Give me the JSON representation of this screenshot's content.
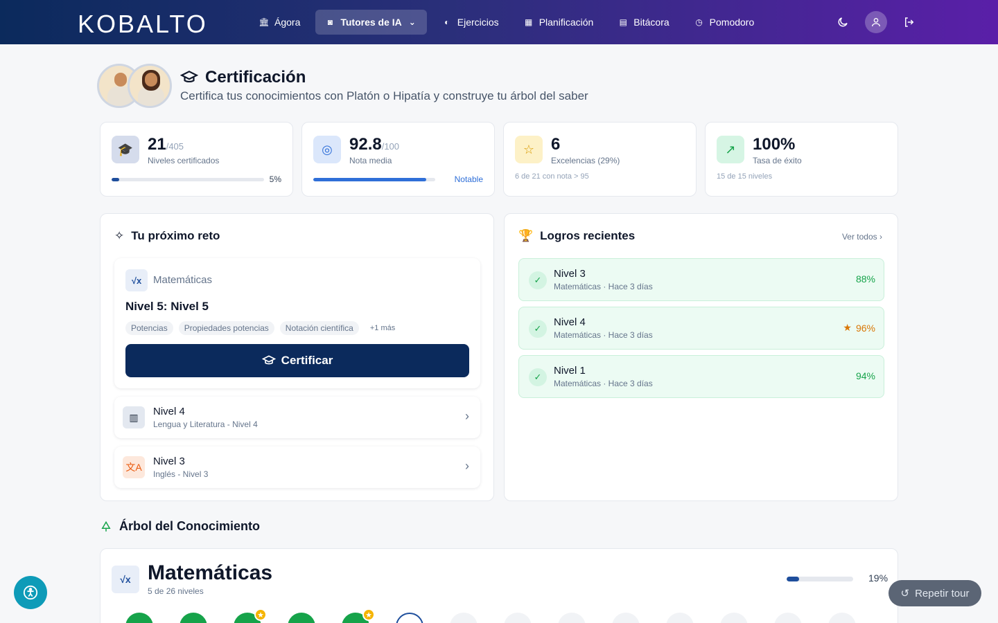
{
  "nav": {
    "logo": "KOBALTO",
    "items": [
      {
        "label": "Ágora",
        "icon": "building-icon"
      },
      {
        "label": "Tutores de IA",
        "icon": "robot-icon",
        "active": true
      },
      {
        "label": "Ejercicios",
        "icon": "brain-icon"
      },
      {
        "label": "Planificación",
        "icon": "calendar-icon"
      },
      {
        "label": "Bitácora",
        "icon": "notebook-icon"
      },
      {
        "label": "Pomodoro",
        "icon": "clock-icon"
      }
    ]
  },
  "header": {
    "title": "Certificación",
    "subtitle": "Certifica tus conocimientos con Platón o Hipatía y construye tu árbol del saber"
  },
  "stats": [
    {
      "value": "21",
      "suffix": "/405",
      "label": "Niveles certificados",
      "progress": 0.05,
      "progress_label": "5%",
      "color": "#1e4e9c"
    },
    {
      "value": "92.8",
      "suffix": "/100",
      "label": "Nota media",
      "progress": 0.928,
      "progress_label": "Notable",
      "color": "#2f6fd8"
    },
    {
      "value": "6",
      "label": "Excelencias (29%)",
      "note": "6 de 21 con nota > 95"
    },
    {
      "value": "100%",
      "label": "Tasa de éxito",
      "note": "15 de 15 niveles"
    }
  ],
  "challenge": {
    "title": "Tu próximo reto",
    "subject": "Matemáticas",
    "level": "Nivel 5: Nivel 5",
    "tags": [
      "Potencias",
      "Propiedades potencias",
      "Notación científica"
    ],
    "more": "+1 más",
    "button": "Certificar",
    "next": [
      {
        "title": "Nivel 4",
        "sub": "Lengua y Literatura - Nivel 4"
      },
      {
        "title": "Nivel 3",
        "sub": "Inglés - Nivel 3"
      }
    ]
  },
  "achievements": {
    "title": "Logros recientes",
    "see_all": "Ver todos",
    "items": [
      {
        "title": "Nivel 3",
        "sub": "Matemáticas · Hace 3 días",
        "score": "88%",
        "star": false
      },
      {
        "title": "Nivel 4",
        "sub": "Matemáticas · Hace 3 días",
        "score": "96%",
        "star": true
      },
      {
        "title": "Nivel 1",
        "sub": "Matemáticas · Hace 3 días",
        "score": "94%",
        "star": false
      }
    ]
  },
  "tree": {
    "title": "Árbol del Conocimiento",
    "subject": "Matemáticas",
    "sub": "5 de 26 niveles",
    "progress": 0.19,
    "progress_label": "19%"
  },
  "tour": "Repetir tour"
}
